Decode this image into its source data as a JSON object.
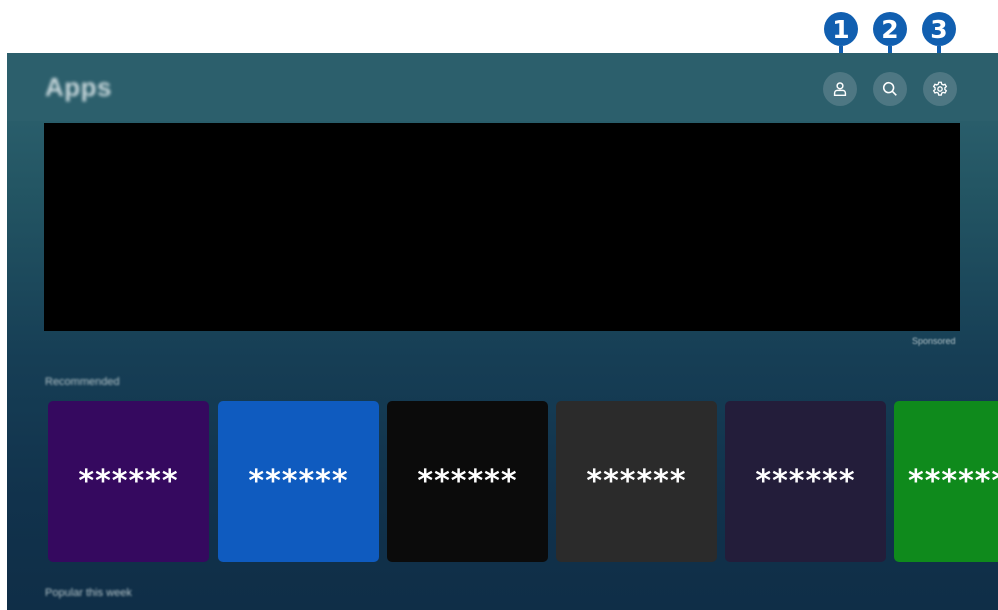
{
  "header": {
    "title": "Apps"
  },
  "buttons": {
    "profile": {
      "icon": "profile-icon"
    },
    "search": {
      "icon": "search-icon"
    },
    "settings": {
      "icon": "gear-icon"
    }
  },
  "banner": {
    "sponsored_label": "Sponsored"
  },
  "sections": {
    "recommended": "Recommended",
    "popular": "Popular this week"
  },
  "recommended_apps": [
    {
      "label": "******",
      "color": "#35095f"
    },
    {
      "label": "******",
      "color": "#0f5bbf"
    },
    {
      "label": "******",
      "color": "#0b0b0b"
    },
    {
      "label": "******",
      "color": "#2b2b2b"
    },
    {
      "label": "******",
      "color": "#231d3a"
    },
    {
      "label": "******",
      "color": "#0f8a1c"
    }
  ],
  "callouts": [
    "1",
    "2",
    "3"
  ],
  "colors": {
    "callout": "#115fb0",
    "topbar": "#2c5f6c",
    "button": "#4e7783"
  }
}
